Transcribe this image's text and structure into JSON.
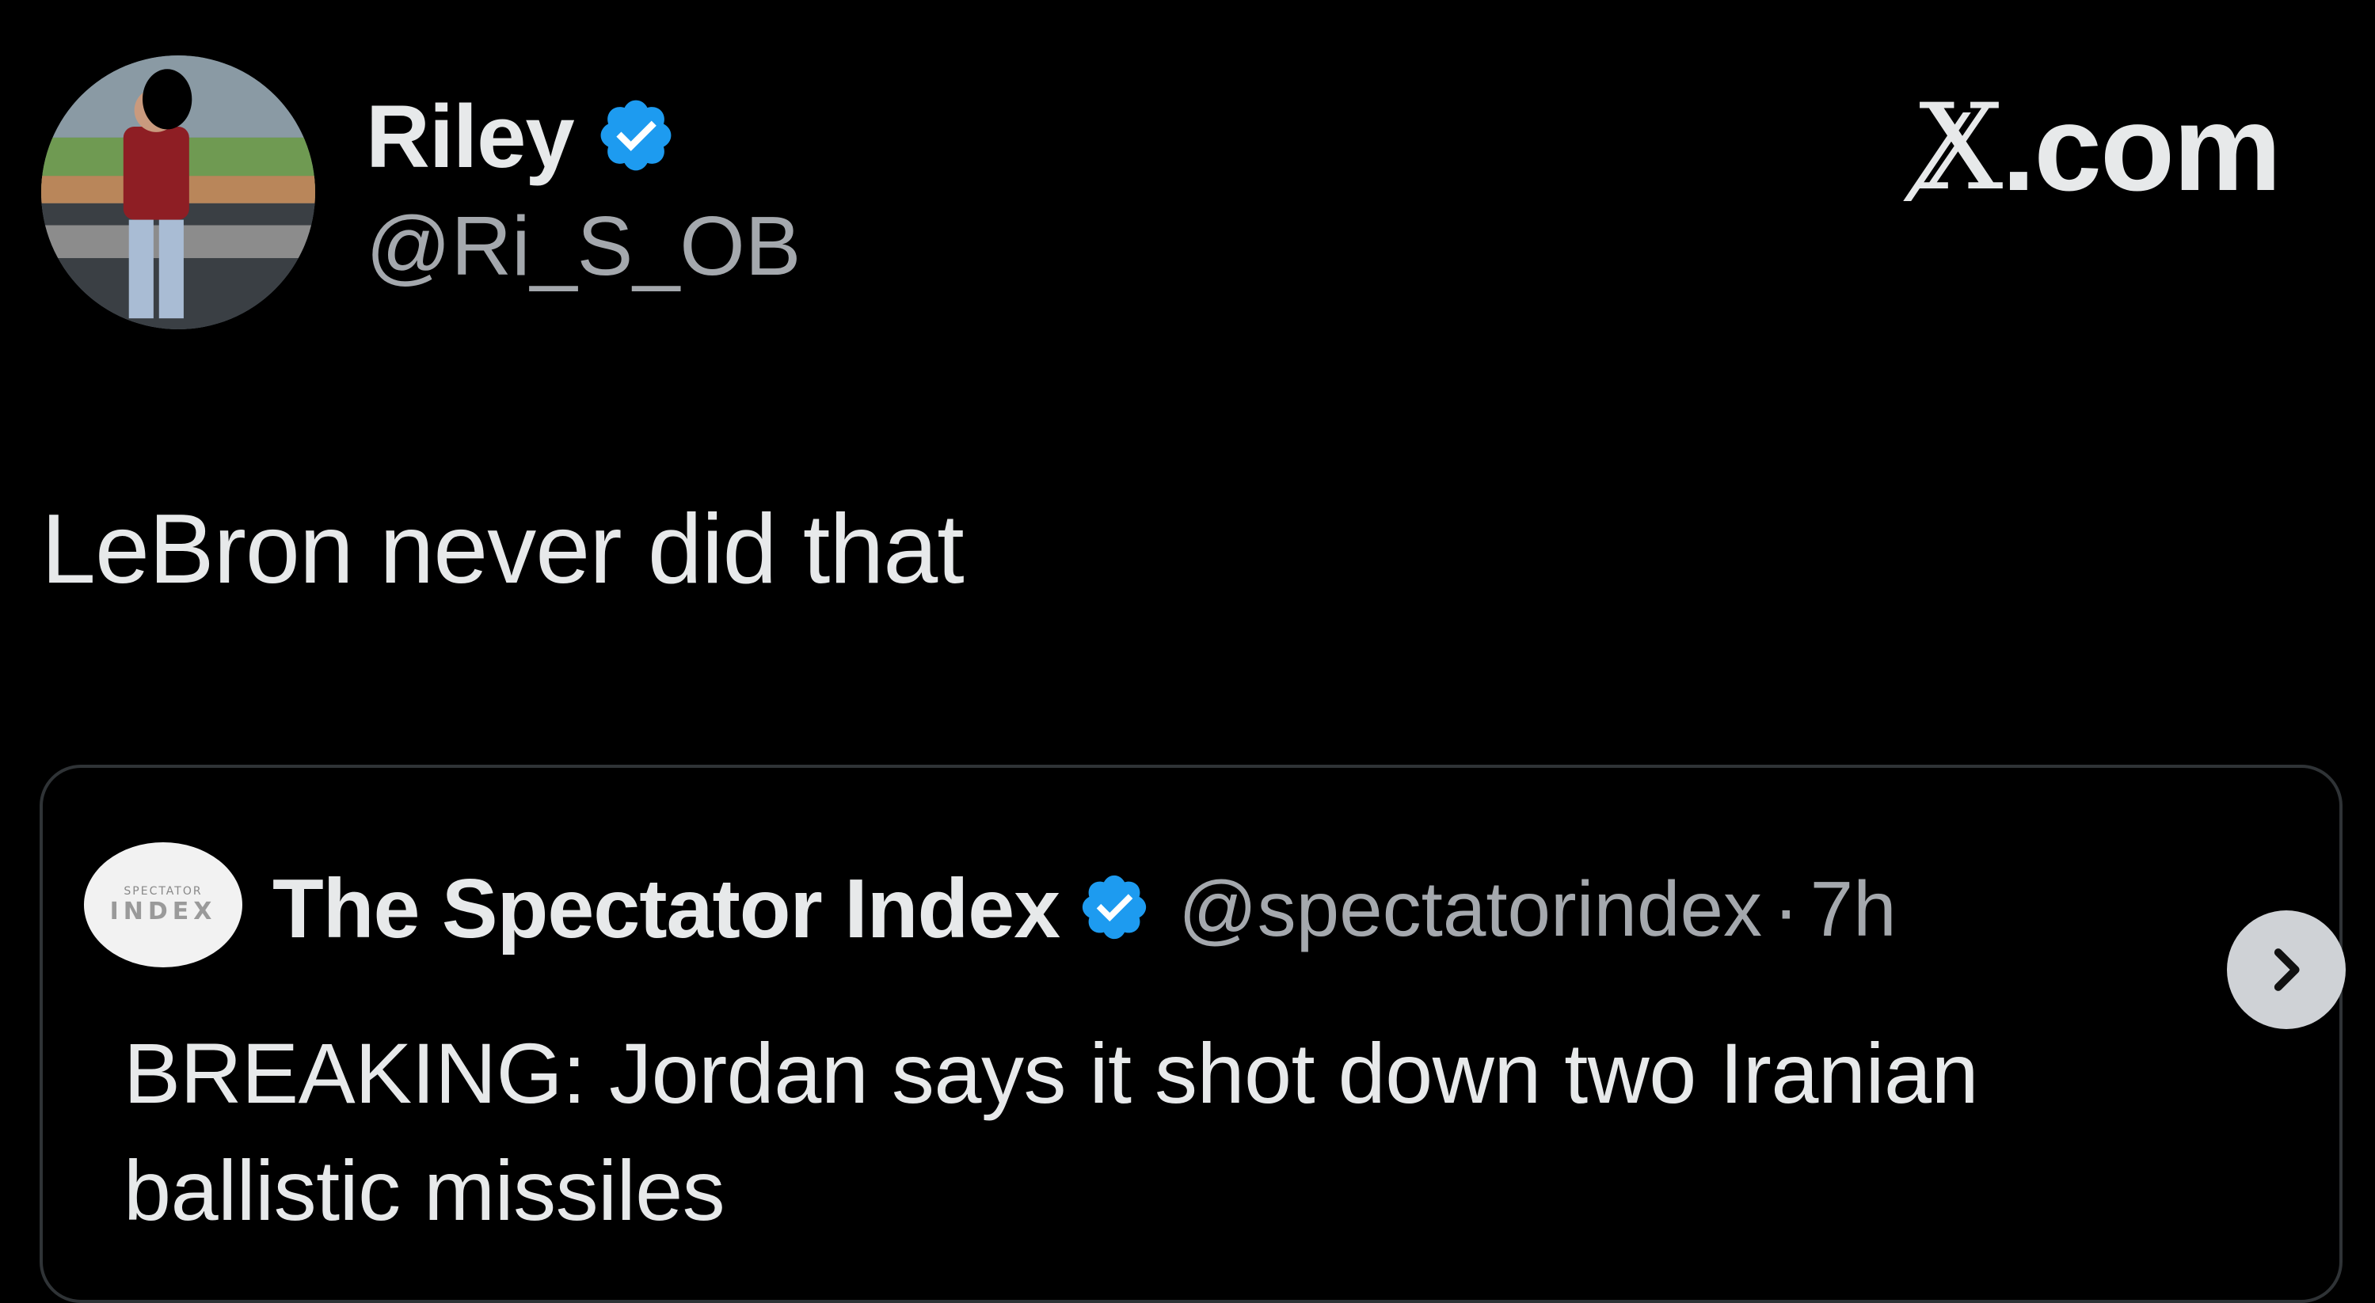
{
  "tweet": {
    "author_name": "Riley",
    "author_handle": "@Ri_S_OB",
    "text": "LeBron never did that"
  },
  "brand": {
    "label": ".com",
    "logo_glyph": "X"
  },
  "quoted_tweet": {
    "author_name": "The Spectator Index",
    "author_handle": "@spectatorindex",
    "separator": "·",
    "time": "7h",
    "avatar_logo_top": "SPECTATOR",
    "avatar_logo_bottom": "INDEX",
    "text": "BREAKING: Jordan says it shot down two Iranian ballistic missiles"
  },
  "icons": {
    "verified": "verified-badge-icon",
    "next": "chevron-right-icon"
  },
  "colors": {
    "background": "#000000",
    "text_primary": "#e7e9ea",
    "text_secondary": "#a4a8ad",
    "verified_blue": "#1d9bf0",
    "card_border": "#2f3336"
  }
}
